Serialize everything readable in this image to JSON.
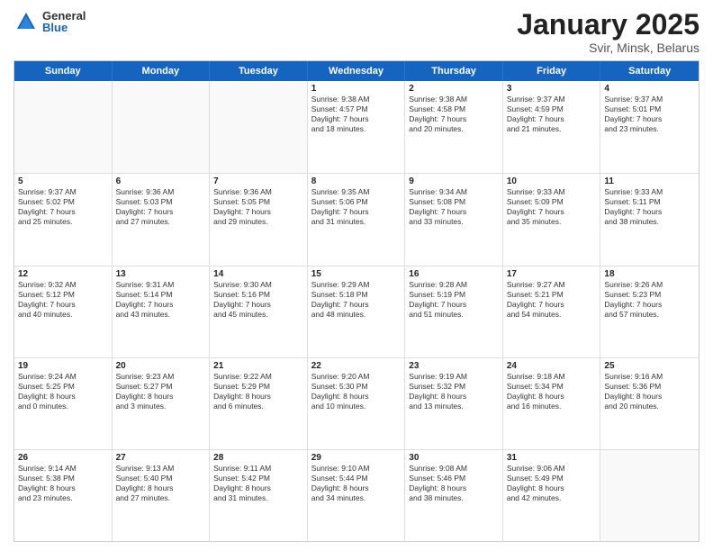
{
  "logo": {
    "general": "General",
    "blue": "Blue"
  },
  "title": "January 2025",
  "subtitle": "Svir, Minsk, Belarus",
  "days": [
    "Sunday",
    "Monday",
    "Tuesday",
    "Wednesday",
    "Thursday",
    "Friday",
    "Saturday"
  ],
  "weeks": [
    [
      {
        "day": "",
        "lines": []
      },
      {
        "day": "",
        "lines": []
      },
      {
        "day": "",
        "lines": []
      },
      {
        "day": "1",
        "lines": [
          "Sunrise: 9:38 AM",
          "Sunset: 4:57 PM",
          "Daylight: 7 hours",
          "and 18 minutes."
        ]
      },
      {
        "day": "2",
        "lines": [
          "Sunrise: 9:38 AM",
          "Sunset: 4:58 PM",
          "Daylight: 7 hours",
          "and 20 minutes."
        ]
      },
      {
        "day": "3",
        "lines": [
          "Sunrise: 9:37 AM",
          "Sunset: 4:59 PM",
          "Daylight: 7 hours",
          "and 21 minutes."
        ]
      },
      {
        "day": "4",
        "lines": [
          "Sunrise: 9:37 AM",
          "Sunset: 5:01 PM",
          "Daylight: 7 hours",
          "and 23 minutes."
        ]
      }
    ],
    [
      {
        "day": "5",
        "lines": [
          "Sunrise: 9:37 AM",
          "Sunset: 5:02 PM",
          "Daylight: 7 hours",
          "and 25 minutes."
        ]
      },
      {
        "day": "6",
        "lines": [
          "Sunrise: 9:36 AM",
          "Sunset: 5:03 PM",
          "Daylight: 7 hours",
          "and 27 minutes."
        ]
      },
      {
        "day": "7",
        "lines": [
          "Sunrise: 9:36 AM",
          "Sunset: 5:05 PM",
          "Daylight: 7 hours",
          "and 29 minutes."
        ]
      },
      {
        "day": "8",
        "lines": [
          "Sunrise: 9:35 AM",
          "Sunset: 5:06 PM",
          "Daylight: 7 hours",
          "and 31 minutes."
        ]
      },
      {
        "day": "9",
        "lines": [
          "Sunrise: 9:34 AM",
          "Sunset: 5:08 PM",
          "Daylight: 7 hours",
          "and 33 minutes."
        ]
      },
      {
        "day": "10",
        "lines": [
          "Sunrise: 9:33 AM",
          "Sunset: 5:09 PM",
          "Daylight: 7 hours",
          "and 35 minutes."
        ]
      },
      {
        "day": "11",
        "lines": [
          "Sunrise: 9:33 AM",
          "Sunset: 5:11 PM",
          "Daylight: 7 hours",
          "and 38 minutes."
        ]
      }
    ],
    [
      {
        "day": "12",
        "lines": [
          "Sunrise: 9:32 AM",
          "Sunset: 5:12 PM",
          "Daylight: 7 hours",
          "and 40 minutes."
        ]
      },
      {
        "day": "13",
        "lines": [
          "Sunrise: 9:31 AM",
          "Sunset: 5:14 PM",
          "Daylight: 7 hours",
          "and 43 minutes."
        ]
      },
      {
        "day": "14",
        "lines": [
          "Sunrise: 9:30 AM",
          "Sunset: 5:16 PM",
          "Daylight: 7 hours",
          "and 45 minutes."
        ]
      },
      {
        "day": "15",
        "lines": [
          "Sunrise: 9:29 AM",
          "Sunset: 5:18 PM",
          "Daylight: 7 hours",
          "and 48 minutes."
        ]
      },
      {
        "day": "16",
        "lines": [
          "Sunrise: 9:28 AM",
          "Sunset: 5:19 PM",
          "Daylight: 7 hours",
          "and 51 minutes."
        ]
      },
      {
        "day": "17",
        "lines": [
          "Sunrise: 9:27 AM",
          "Sunset: 5:21 PM",
          "Daylight: 7 hours",
          "and 54 minutes."
        ]
      },
      {
        "day": "18",
        "lines": [
          "Sunrise: 9:26 AM",
          "Sunset: 5:23 PM",
          "Daylight: 7 hours",
          "and 57 minutes."
        ]
      }
    ],
    [
      {
        "day": "19",
        "lines": [
          "Sunrise: 9:24 AM",
          "Sunset: 5:25 PM",
          "Daylight: 8 hours",
          "and 0 minutes."
        ]
      },
      {
        "day": "20",
        "lines": [
          "Sunrise: 9:23 AM",
          "Sunset: 5:27 PM",
          "Daylight: 8 hours",
          "and 3 minutes."
        ]
      },
      {
        "day": "21",
        "lines": [
          "Sunrise: 9:22 AM",
          "Sunset: 5:29 PM",
          "Daylight: 8 hours",
          "and 6 minutes."
        ]
      },
      {
        "day": "22",
        "lines": [
          "Sunrise: 9:20 AM",
          "Sunset: 5:30 PM",
          "Daylight: 8 hours",
          "and 10 minutes."
        ]
      },
      {
        "day": "23",
        "lines": [
          "Sunrise: 9:19 AM",
          "Sunset: 5:32 PM",
          "Daylight: 8 hours",
          "and 13 minutes."
        ]
      },
      {
        "day": "24",
        "lines": [
          "Sunrise: 9:18 AM",
          "Sunset: 5:34 PM",
          "Daylight: 8 hours",
          "and 16 minutes."
        ]
      },
      {
        "day": "25",
        "lines": [
          "Sunrise: 9:16 AM",
          "Sunset: 5:36 PM",
          "Daylight: 8 hours",
          "and 20 minutes."
        ]
      }
    ],
    [
      {
        "day": "26",
        "lines": [
          "Sunrise: 9:14 AM",
          "Sunset: 5:38 PM",
          "Daylight: 8 hours",
          "and 23 minutes."
        ]
      },
      {
        "day": "27",
        "lines": [
          "Sunrise: 9:13 AM",
          "Sunset: 5:40 PM",
          "Daylight: 8 hours",
          "and 27 minutes."
        ]
      },
      {
        "day": "28",
        "lines": [
          "Sunrise: 9:11 AM",
          "Sunset: 5:42 PM",
          "Daylight: 8 hours",
          "and 31 minutes."
        ]
      },
      {
        "day": "29",
        "lines": [
          "Sunrise: 9:10 AM",
          "Sunset: 5:44 PM",
          "Daylight: 8 hours",
          "and 34 minutes."
        ]
      },
      {
        "day": "30",
        "lines": [
          "Sunrise: 9:08 AM",
          "Sunset: 5:46 PM",
          "Daylight: 8 hours",
          "and 38 minutes."
        ]
      },
      {
        "day": "31",
        "lines": [
          "Sunrise: 9:06 AM",
          "Sunset: 5:49 PM",
          "Daylight: 8 hours",
          "and 42 minutes."
        ]
      },
      {
        "day": "",
        "lines": []
      }
    ]
  ]
}
